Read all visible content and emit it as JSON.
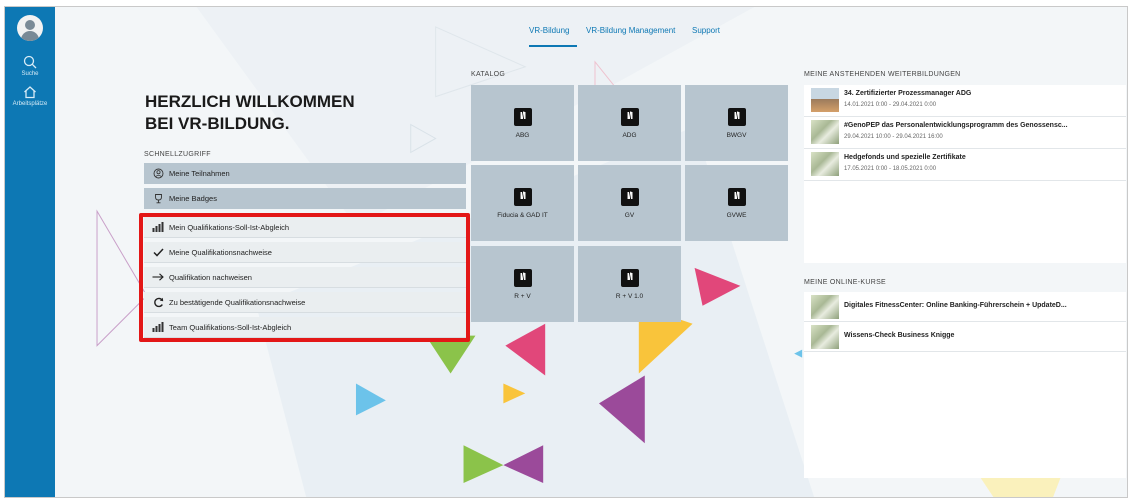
{
  "nav": {
    "tabs": [
      "VR-Bildung",
      "VR-Bildung Management",
      "Support"
    ]
  },
  "sidebar": {
    "items": [
      {
        "label": "Suche",
        "icon": "search-icon"
      },
      {
        "label": "Arbeitsplätze",
        "icon": "home-icon"
      }
    ]
  },
  "welcome": {
    "line1": "HERZLICH WILLKOMMEN",
    "line2": "BEI VR-BILDUNG."
  },
  "quick_access": {
    "label": "SCHNELLZUGRIFF",
    "items": [
      {
        "label": "Meine Teilnahmen",
        "icon": "participation-icon"
      },
      {
        "label": "Meine Badges",
        "icon": "trophy-icon"
      },
      {
        "label": "Mein Qualifikations-Soll-Ist-Abgleich",
        "icon": "bar-chart-icon"
      },
      {
        "label": "Meine Qualifikationsnachweise",
        "icon": "checkmark-icon"
      },
      {
        "label": "Qualifikation nachweisen",
        "icon": "arrow-right-icon"
      },
      {
        "label": "Zu bestätigende Qualifikationsnachweise",
        "icon": "refresh-icon"
      },
      {
        "label": "Team Qualifikations-Soll-Ist-Abgleich",
        "icon": "bar-chart-icon"
      }
    ]
  },
  "catalog": {
    "label": "KATALOG",
    "logo_text": "I/I",
    "tiles": [
      "ABG",
      "ADG",
      "BWGV",
      "Fiducia & GAD IT",
      "GV",
      "GVWE",
      "R + V",
      "R + V 1.0"
    ]
  },
  "upcoming": {
    "label": "MEINE ANSTEHENDEN WEITERBILDUNGEN",
    "items": [
      {
        "title": "34. Zertifizierter Prozessmanager ADG",
        "date": "14.01.2021 0:00 - 29.04.2021 0:00"
      },
      {
        "title": "#GenoPEP das Personalentwicklungsprogramm des Genossensc...",
        "date": "29.04.2021 10:00 - 29.04.2021 16:00"
      },
      {
        "title": "Hedgefonds und spezielle Zertifikate",
        "date": "17.05.2021 0:00 - 18.05.2021 0:00"
      }
    ]
  },
  "online_courses": {
    "label": "MEINE ONLINE-KURSE",
    "items": [
      {
        "title": "Digitales FitnessCenter: Online Banking-Führerschein + UpdateD..."
      },
      {
        "title": "Wissens-Check Business Knigge"
      }
    ]
  },
  "colors": {
    "sidebar": "#0d78b4",
    "tile": "#b7c5cf",
    "highlight": "#e31717"
  }
}
